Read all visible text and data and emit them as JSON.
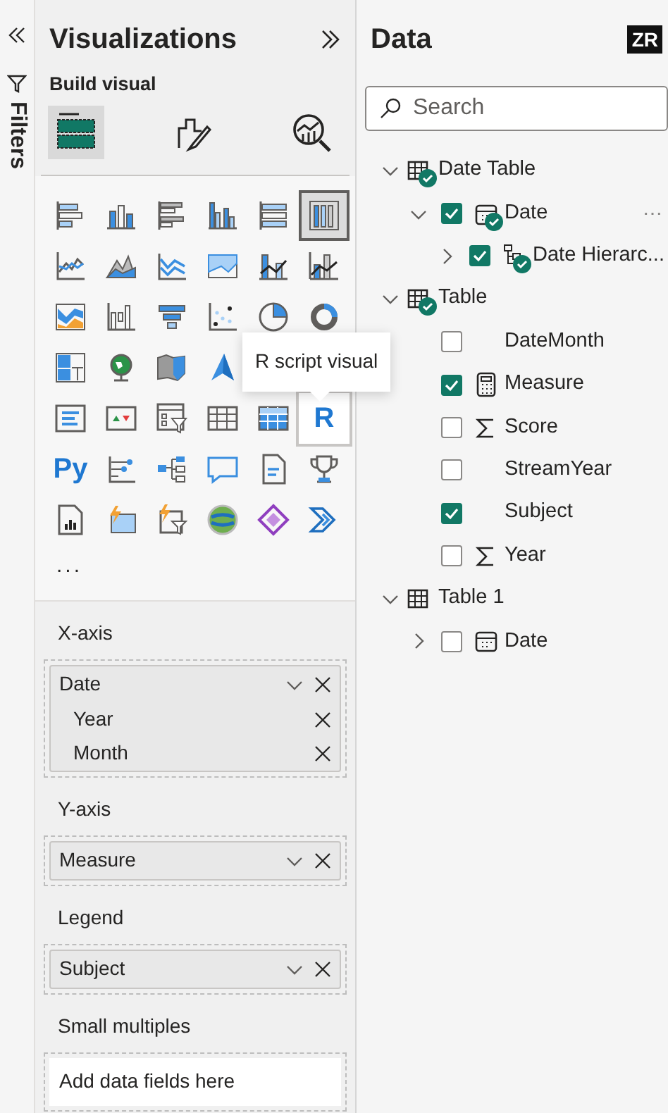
{
  "filters_pane": {
    "title": "Filters"
  },
  "visualizations": {
    "title": "Visualizations",
    "section": "Build visual",
    "build_tabs": [
      {
        "kind": "fields",
        "selected": true
      },
      {
        "kind": "format",
        "selected": false
      },
      {
        "kind": "analytics",
        "selected": false
      }
    ],
    "visual_types": [
      {
        "kind": "stacked-bar",
        "selected": false,
        "hovered": false
      },
      {
        "kind": "stacked-column",
        "selected": false,
        "hovered": false
      },
      {
        "kind": "clustered-bar",
        "selected": false,
        "hovered": false
      },
      {
        "kind": "clustered-column",
        "selected": false,
        "hovered": false
      },
      {
        "kind": "bar-100",
        "selected": false,
        "hovered": false
      },
      {
        "kind": "column-100",
        "selected": true,
        "hovered": false
      },
      {
        "kind": "line",
        "selected": false,
        "hovered": false
      },
      {
        "kind": "area",
        "selected": false,
        "hovered": false
      },
      {
        "kind": "stacked-area",
        "selected": false,
        "hovered": false
      },
      {
        "kind": "area-inverted",
        "selected": false,
        "hovered": false
      },
      {
        "kind": "line-column",
        "selected": false,
        "hovered": false
      },
      {
        "kind": "line-column-2",
        "selected": false,
        "hovered": false
      },
      {
        "kind": "ribbon",
        "selected": false,
        "hovered": false
      },
      {
        "kind": "waterfall",
        "selected": false,
        "hovered": false
      },
      {
        "kind": "funnel",
        "selected": false,
        "hovered": false
      },
      {
        "kind": "scatter",
        "selected": false,
        "hovered": false
      },
      {
        "kind": "pie",
        "selected": false,
        "hovered": false
      },
      {
        "kind": "donut",
        "selected": false,
        "hovered": false
      },
      {
        "kind": "treemap",
        "selected": false,
        "hovered": false
      },
      {
        "kind": "globe",
        "selected": false,
        "hovered": false
      },
      {
        "kind": "filled-map",
        "selected": false,
        "hovered": false
      },
      {
        "kind": "azure-map",
        "selected": false,
        "hovered": false
      },
      {
        "kind": "blank"
      },
      {
        "kind": "blank"
      },
      {
        "kind": "card",
        "selected": false,
        "hovered": false
      },
      {
        "kind": "kpi",
        "selected": false,
        "hovered": false
      },
      {
        "kind": "slicer",
        "selected": false,
        "hovered": false
      },
      {
        "kind": "table",
        "selected": false,
        "hovered": false
      },
      {
        "kind": "matrix",
        "selected": false,
        "hovered": false
      },
      {
        "kind": "letter",
        "label": "R",
        "selected": false,
        "hovered": true
      },
      {
        "kind": "letter",
        "label": "Py",
        "selected": false,
        "hovered": false
      },
      {
        "kind": "key-influencers",
        "selected": false,
        "hovered": false
      },
      {
        "kind": "decomposition",
        "selected": false,
        "hovered": false
      },
      {
        "kind": "qna",
        "selected": false,
        "hovered": false
      },
      {
        "kind": "narrative",
        "selected": false,
        "hovered": false
      },
      {
        "kind": "trophy",
        "selected": false,
        "hovered": false
      },
      {
        "kind": "paginated",
        "selected": false,
        "hovered": false
      },
      {
        "kind": "lightning-card",
        "selected": false,
        "hovered": false
      },
      {
        "kind": "lightning-slicer",
        "selected": false,
        "hovered": false
      },
      {
        "kind": "sphere",
        "selected": false,
        "hovered": false
      },
      {
        "kind": "diamond",
        "selected": false,
        "hovered": false
      },
      {
        "kind": "chevrons",
        "selected": false,
        "hovered": false
      }
    ],
    "more": "...",
    "tooltip": "R script visual",
    "wells": [
      {
        "title": "X-axis",
        "fields": [
          {
            "label": "Date",
            "children": [
              {
                "label": "Year"
              },
              {
                "label": "Month"
              }
            ]
          }
        ]
      },
      {
        "title": "Y-axis",
        "fields": [
          {
            "label": "Measure"
          }
        ]
      },
      {
        "title": "Legend",
        "fields": [
          {
            "label": "Subject"
          }
        ]
      },
      {
        "title": "Small multiples",
        "placeholder": "Add data fields here"
      }
    ]
  },
  "data": {
    "title": "Data",
    "user_badge": "ZR",
    "search": {
      "placeholder": "Search"
    },
    "tree": [
      {
        "label": "Date Table",
        "kind": "table",
        "in_use": true,
        "expanded": true,
        "children": [
          {
            "label": "Date",
            "kind": "calendar",
            "in_use": true,
            "checked": true,
            "expanded": true,
            "more": "⋯",
            "children": [
              {
                "label": "Date Hierarc...",
                "kind": "hierarchy",
                "in_use": true,
                "checked": true,
                "expanded": false
              }
            ]
          }
        ]
      },
      {
        "label": "Table",
        "kind": "table",
        "in_use": true,
        "expanded": true,
        "children": [
          {
            "label": "DateMonth",
            "checked": false
          },
          {
            "label": "Measure",
            "kind": "calculator",
            "in_use": false,
            "checked": true
          },
          {
            "label": "Score",
            "kind": "sigma",
            "in_use": false,
            "checked": false
          },
          {
            "label": "StreamYear",
            "checked": false
          },
          {
            "label": "Subject",
            "checked": true
          },
          {
            "label": "Year",
            "kind": "sigma",
            "in_use": false,
            "checked": false
          }
        ]
      },
      {
        "label": "Table 1",
        "kind": "table",
        "in_use": false,
        "expanded": true,
        "children": [
          {
            "label": "Date",
            "kind": "calendar",
            "in_use": false,
            "checked": false,
            "expanded": false
          }
        ]
      }
    ]
  }
}
